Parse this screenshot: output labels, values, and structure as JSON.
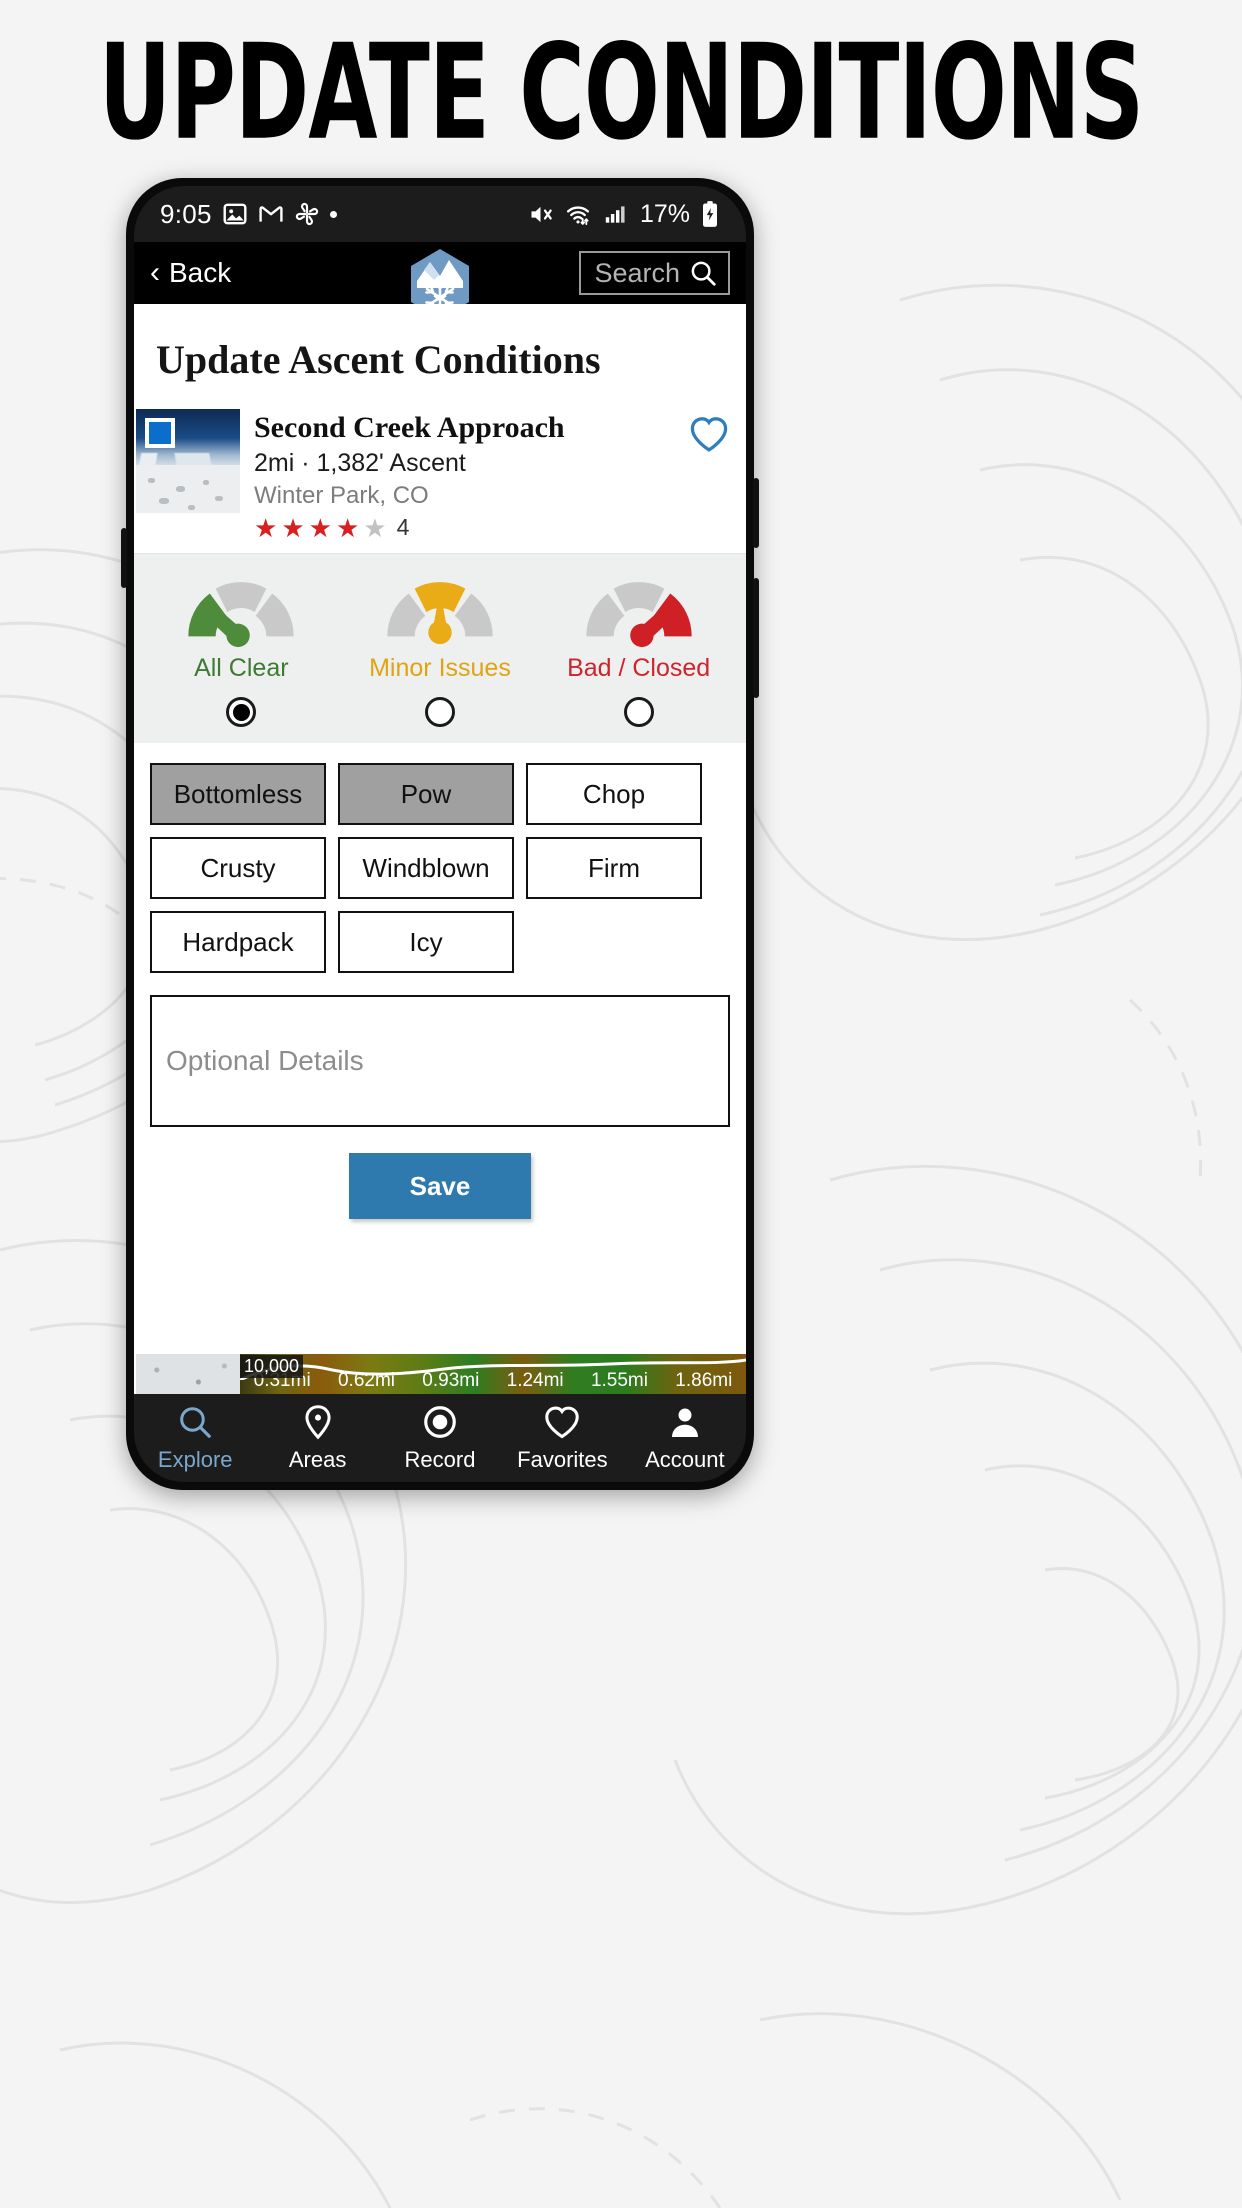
{
  "page": {
    "title": "UPDATE CONDITIONS"
  },
  "statusbar": {
    "time": "9:05",
    "icons_left": [
      "image-icon",
      "gmail-icon",
      "google-photos-icon",
      "dot-icon"
    ],
    "icons_right": [
      "mute-icon",
      "wifi-icon",
      "cell-signal-icon"
    ],
    "battery_percent": "17%",
    "battery_state": "charging"
  },
  "appbar": {
    "back_label": "Back",
    "logo": "snowflake-mountain-hex-logo",
    "search_placeholder": "Search"
  },
  "screen": {
    "heading": "Update Ascent Conditions"
  },
  "trail": {
    "name": "Second Creek Approach",
    "stats": "2mi · 1,382' Ascent",
    "location": "Winter Park, CO",
    "rating": 4,
    "rating_max": 5,
    "rating_count": "4",
    "difficulty_badge": "blue-square",
    "favorite_icon": "heart-outline-icon",
    "star_on_color": "#d91f1f",
    "star_off_color": "#c2c2c2"
  },
  "status_options": [
    {
      "label": "All Clear",
      "color": "#3f7a33",
      "selected": true,
      "needle": "left"
    },
    {
      "label": "Minor Issues",
      "color": "#e0a412",
      "selected": false,
      "needle": "up"
    },
    {
      "label": "Bad / Closed",
      "color": "#d0242c",
      "selected": false,
      "needle": "right"
    }
  ],
  "chips": [
    {
      "label": "Bottomless",
      "selected": true
    },
    {
      "label": "Pow",
      "selected": true
    },
    {
      "label": "Chop",
      "selected": false
    },
    {
      "label": "Crusty",
      "selected": false
    },
    {
      "label": "Windblown",
      "selected": false
    },
    {
      "label": "Firm",
      "selected": false
    },
    {
      "label": "Hardpack",
      "selected": false
    },
    {
      "label": "Icy",
      "selected": false
    }
  ],
  "details": {
    "placeholder": "Optional Details"
  },
  "save": {
    "label": "Save",
    "color": "#2e79ad"
  },
  "elevation_peek": {
    "altitude_label": "10,000",
    "ticks": [
      "0.31mi",
      "0.62mi",
      "0.93mi",
      "1.24mi",
      "1.55mi",
      "1.86mi"
    ]
  },
  "bottom_nav": [
    {
      "label": "Explore",
      "icon": "search-icon",
      "active": true
    },
    {
      "label": "Areas",
      "icon": "pin-icon",
      "active": false
    },
    {
      "label": "Record",
      "icon": "record-icon",
      "active": false
    },
    {
      "label": "Favorites",
      "icon": "heart-icon",
      "active": false
    },
    {
      "label": "Account",
      "icon": "person-icon",
      "active": false
    }
  ],
  "accent_color": "#7aa7cc"
}
